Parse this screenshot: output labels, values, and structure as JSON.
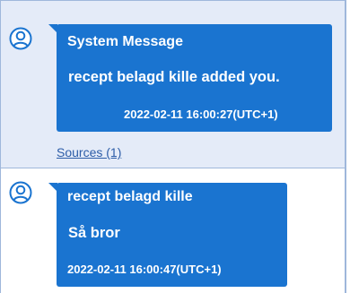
{
  "messages": [
    {
      "sender": "System Message",
      "text": "recept belagd kille added you.",
      "timestamp": "2022-02-11 16:00:27(UTC+1)",
      "sources_label": "Sources (1)",
      "avatar_icon": "user-avatar-icon"
    },
    {
      "sender": "recept belagd kille",
      "text": "Så bror",
      "timestamp": "2022-02-11 16:00:47(UTC+1)",
      "avatar_icon": "user-avatar-icon"
    }
  ],
  "colors": {
    "bubble": "#1a74d0",
    "selected_row": "#e4ebf8",
    "row_border": "#9fb7db",
    "link": "#2d5da8",
    "avatar": "#1a74d0"
  }
}
